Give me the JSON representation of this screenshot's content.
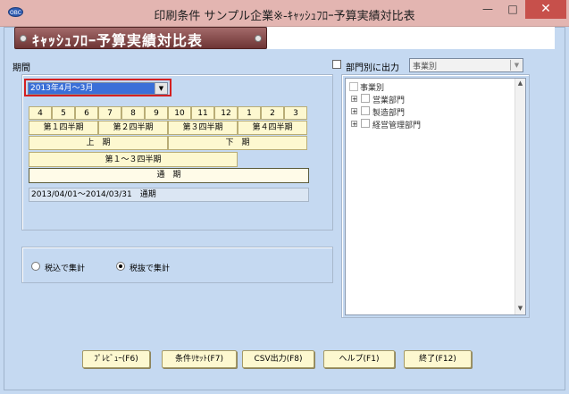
{
  "window": {
    "title": "印刷条件 サンプル企業※-ｷｬｯｼｭﾌﾛｰ予算実績対比表",
    "app_icon_text": "OBC",
    "minimize_symbol": "—",
    "maximize_symbol": "□",
    "close_symbol": "✕"
  },
  "banner": {
    "title": "ｷｬｯｼｭﾌﾛｰ予算実績対比表"
  },
  "period": {
    "label": "期間",
    "selected": "2013年4月～3月",
    "dropdown_arrow": "▼",
    "months": [
      "4",
      "5",
      "6",
      "7",
      "8",
      "9",
      "10",
      "11",
      "12",
      "1",
      "2",
      "3"
    ],
    "quarters": [
      "第１四半期",
      "第２四半期",
      "第３四半期",
      "第４四半期"
    ],
    "halves": [
      "上　期",
      "下　期"
    ],
    "q1_3": "第１～３四半期",
    "full_year": "通　期",
    "range_text": "2013/04/01～2014/03/31　通期"
  },
  "tax": {
    "options": [
      "税込で集計",
      "税抜で集計"
    ],
    "selected_index": 1
  },
  "department": {
    "checkbox_label": "部門別に出力",
    "checked": false,
    "select_value": "事業別",
    "select_arrow": "▼",
    "tree_root": "事業別",
    "tree_children": [
      "営業部門",
      "製造部門",
      "経営管理部門"
    ],
    "expander_symbol": "+",
    "scroll_up": "▲",
    "scroll_down": "▼"
  },
  "buttons": {
    "preview": "ﾌﾟﾚﾋﾞｭｰ(F6)",
    "reset": "条件ﾘｾｯﾄ(F7)",
    "csv": "CSV出力(F8)",
    "help": "ヘルプ(F1)",
    "exit": "終了(F12)"
  }
}
